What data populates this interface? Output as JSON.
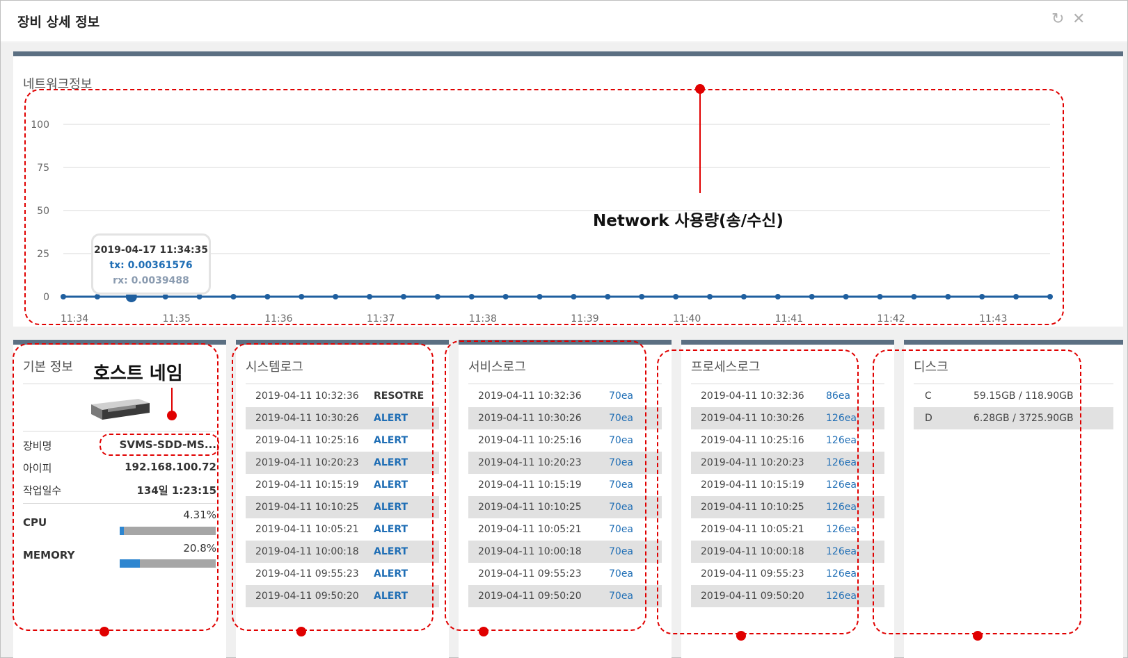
{
  "window": {
    "title": "장비 상세 정보",
    "refresh_icon": "refresh-icon",
    "close_icon": "close-icon"
  },
  "network": {
    "title": "네트워크정보",
    "tooltip": {
      "time": "2019-04-17 11:34:35",
      "tx": "tx: 0.00361576",
      "rx": "rx: 0.0039488"
    }
  },
  "chart_data": {
    "type": "line",
    "x_ticks": [
      "11:34",
      "11:35",
      "11:36",
      "11:37",
      "11:38",
      "11:39",
      "11:40",
      "11:41",
      "11:42",
      "11:43"
    ],
    "y_ticks": [
      0,
      25,
      50,
      75,
      100
    ],
    "ylim": [
      0,
      100
    ],
    "series": [
      {
        "name": "tx",
        "values": [
          0.0036,
          0.0036,
          0.0036,
          0.0036,
          0.0036,
          0.0036,
          0.0036,
          0.0036,
          0.0036,
          0.0036,
          0.0036,
          0.0036,
          0.0036,
          0.0036,
          0.0036,
          0.0036,
          0.0036,
          0.0036,
          0.0036,
          0.0036,
          0.0036,
          0.0036,
          0.0036,
          0.0036,
          0.0036,
          0.0036,
          0.0036,
          0.0036,
          0.0036,
          0.0036
        ]
      },
      {
        "name": "rx",
        "values": [
          0.0039,
          0.0039,
          0.0039,
          0.0039,
          0.0039,
          0.0039,
          0.0039,
          0.0039,
          0.0039,
          0.0039,
          0.0039,
          0.0039,
          0.0039,
          0.0039,
          0.0039,
          0.0039,
          0.0039,
          0.0039,
          0.0039,
          0.0039,
          0.0039,
          0.0039,
          0.0039,
          0.0039,
          0.0039,
          0.0039,
          0.0039,
          0.0039,
          0.0039,
          0.0039
        ]
      }
    ],
    "highlight_index": 2,
    "colors": {
      "line": "#1f5f9f",
      "grid": "#d9d9d9"
    }
  },
  "basic": {
    "title": "기본 정보",
    "image_icon": "server-icon",
    "rows": [
      {
        "label": "장비명",
        "value": "SVMS-SDD-MS..."
      },
      {
        "label": "아이피",
        "value": "192.168.100.72"
      },
      {
        "label": "작업일수",
        "value": "134일 1:23:15"
      }
    ],
    "resources": [
      {
        "label": "CPU",
        "value": "4.31%",
        "level": 4.31
      },
      {
        "label": "MEMORY",
        "value": "20.8%",
        "level": 20.8
      }
    ]
  },
  "system_log": {
    "title": "시스템로그",
    "rows": [
      {
        "time": "2019-04-11 10:32:36",
        "status": "RESOTRE"
      },
      {
        "time": "2019-04-11 10:30:26",
        "status": "ALERT"
      },
      {
        "time": "2019-04-11 10:25:16",
        "status": "ALERT"
      },
      {
        "time": "2019-04-11 10:20:23",
        "status": "ALERT"
      },
      {
        "time": "2019-04-11 10:15:19",
        "status": "ALERT"
      },
      {
        "time": "2019-04-11 10:10:25",
        "status": "ALERT"
      },
      {
        "time": "2019-04-11 10:05:21",
        "status": "ALERT"
      },
      {
        "time": "2019-04-11 10:00:18",
        "status": "ALERT"
      },
      {
        "time": "2019-04-11 09:55:23",
        "status": "ALERT"
      },
      {
        "time": "2019-04-11 09:50:20",
        "status": "ALERT"
      }
    ]
  },
  "service_log": {
    "title": "서비스로그",
    "rows": [
      {
        "time": "2019-04-11 10:32:36",
        "count": "70ea"
      },
      {
        "time": "2019-04-11 10:30:26",
        "count": "70ea"
      },
      {
        "time": "2019-04-11 10:25:16",
        "count": "70ea"
      },
      {
        "time": "2019-04-11 10:20:23",
        "count": "70ea"
      },
      {
        "time": "2019-04-11 10:15:19",
        "count": "70ea"
      },
      {
        "time": "2019-04-11 10:10:25",
        "count": "70ea"
      },
      {
        "time": "2019-04-11 10:05:21",
        "count": "70ea"
      },
      {
        "time": "2019-04-11 10:00:18",
        "count": "70ea"
      },
      {
        "time": "2019-04-11 09:55:23",
        "count": "70ea"
      },
      {
        "time": "2019-04-11 09:50:20",
        "count": "70ea"
      }
    ]
  },
  "process_log": {
    "title": "프로세스로그",
    "rows": [
      {
        "time": "2019-04-11 10:32:36",
        "count": "86ea"
      },
      {
        "time": "2019-04-11 10:30:26",
        "count": "126ea"
      },
      {
        "time": "2019-04-11 10:25:16",
        "count": "126ea"
      },
      {
        "time": "2019-04-11 10:20:23",
        "count": "126ea"
      },
      {
        "time": "2019-04-11 10:15:19",
        "count": "126ea"
      },
      {
        "time": "2019-04-11 10:10:25",
        "count": "126ea"
      },
      {
        "time": "2019-04-11 10:05:21",
        "count": "126ea"
      },
      {
        "time": "2019-04-11 10:00:18",
        "count": "126ea"
      },
      {
        "time": "2019-04-11 09:55:23",
        "count": "126ea"
      },
      {
        "time": "2019-04-11 09:50:20",
        "count": "126ea"
      }
    ]
  },
  "disk": {
    "title": "디스크",
    "rows": [
      {
        "name": "C",
        "size": "59.15GB / 118.90GB"
      },
      {
        "name": "D",
        "size": "6.28GB / 3725.90GB"
      }
    ]
  },
  "annotations": {
    "network_label": "Network 사용량(송/수신)",
    "hostname_label": "호스트 네임"
  }
}
